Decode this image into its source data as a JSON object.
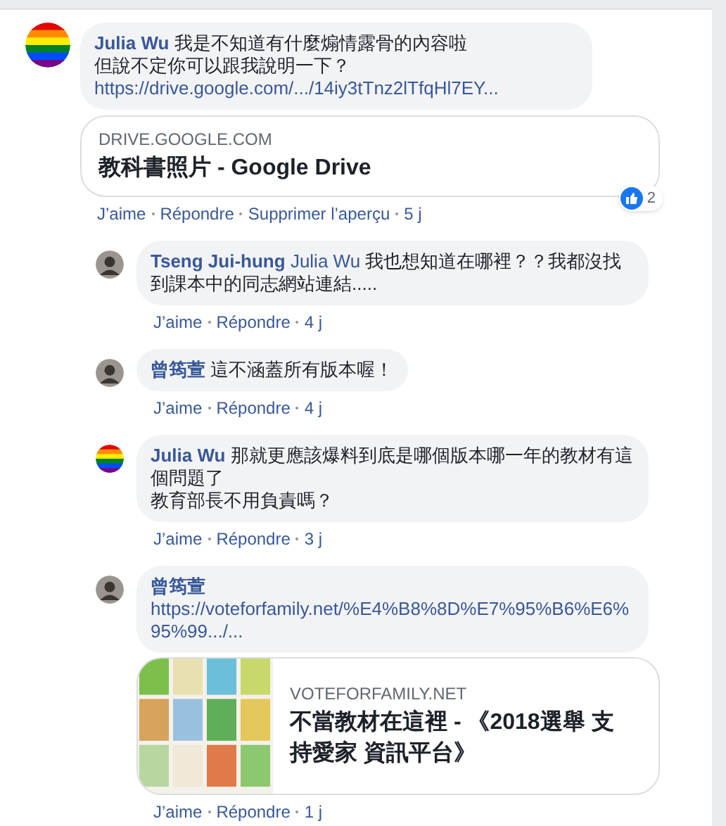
{
  "comments": [
    {
      "author": "Julia Wu",
      "kind": "flag_avatar",
      "lines": [
        "我是不知道有什麼煽情露骨的內容啦",
        "但說不定你可以跟我說明一下？"
      ],
      "link": "https://drive.google.com/.../14iy3tTnz2lTfqHl7EY...",
      "preview": {
        "domain": "DRIVE.GOOGLE.COM",
        "title": "教科書照片 - Google Drive"
      },
      "actions": [
        "J’aime",
        "Répondre",
        "Supprimer l’aperçu"
      ],
      "time": "5 j",
      "reactions": "2",
      "replies": [
        {
          "author": "Tseng Jui-hung",
          "kind": "photo_avatar",
          "mention": "Julia Wu",
          "lines": [
            "我也想知道在哪裡？？我都沒找到課本中的同志網站連結....."
          ],
          "actions": [
            "J’aime",
            "Répondre"
          ],
          "time": "4 j"
        },
        {
          "author": "曾筠萱",
          "kind": "photo_avatar",
          "lines": [
            "這不涵蓋所有版本喔！"
          ],
          "actions": [
            "J’aime",
            "Répondre"
          ],
          "time": "4 j"
        },
        {
          "author": "Julia Wu",
          "kind": "flag_avatar",
          "lines": [
            "那就更應該爆料到底是哪個版本哪一年的教材有這個問題了",
            "教育部長不用負責嗎？"
          ],
          "actions": [
            "J’aime",
            "Répondre"
          ],
          "time": "3 j"
        },
        {
          "author": "曾筠萱",
          "kind": "photo_avatar",
          "link": "https://voteforfamily.net/%E4%B8%8D%E7%95%B6%E6%95%99.../...",
          "preview": {
            "domain": "VOTEFORFAMILY.NET",
            "title": "不當教材在這裡 - 《2018選舉 支持愛家 資訊平台》"
          },
          "actions": [
            "J’aime",
            "Répondre"
          ],
          "time": "1 j"
        }
      ]
    }
  ]
}
